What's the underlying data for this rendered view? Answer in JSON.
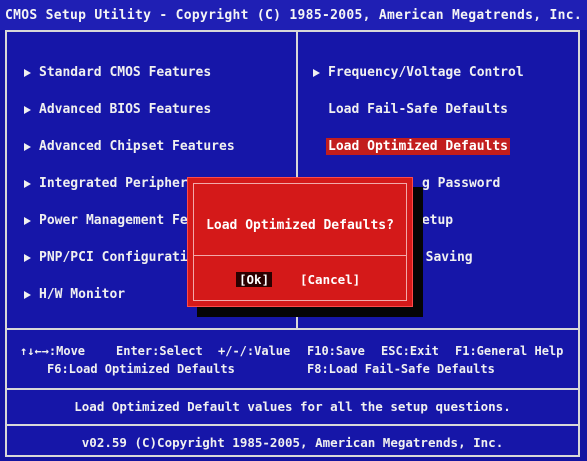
{
  "title": "CMOS Setup Utility - Copyright (C) 1985-2005, American Megatrends, Inc.",
  "left_menu": [
    {
      "label": "Standard CMOS Features"
    },
    {
      "label": "Advanced BIOS Features"
    },
    {
      "label": "Advanced Chipset Features"
    },
    {
      "label": "Integrated Periphera"
    },
    {
      "label": "Power Management Fea"
    },
    {
      "label": "PNP/PCI Configuratio"
    },
    {
      "label": "H/W Monitor"
    }
  ],
  "right_menu": [
    {
      "label": "Frequency/Voltage Control"
    },
    {
      "label": "Load Fail-Safe Defaults"
    },
    {
      "label": "Load Optimized Defaults"
    },
    {
      "label": "g Password"
    },
    {
      "label": "Setup"
    },
    {
      "label": "t Saving"
    }
  ],
  "help": {
    "move": "↑↓←→:Move",
    "select": "Enter:Select",
    "value": "+/-/:Value",
    "save": "F10:Save",
    "exit": "ESC:Exit",
    "general_help": "F1:General Help",
    "f6": "F6:Load Optimized Defaults",
    "f8": "F8:Load Fail-Safe Defaults"
  },
  "status_text": "Load Optimized Default values for all the setup questions.",
  "footer": "v02.59 (C)Copyright 1985-2005, American Megatrends, Inc.",
  "dialog": {
    "message": "Load Optimized Defaults?",
    "ok_label": "[Ok]",
    "cancel_label": "[Cancel]"
  },
  "colors": {
    "background": "#1414a0",
    "dialog": "#d41919",
    "highlight": "#c21d1d"
  }
}
